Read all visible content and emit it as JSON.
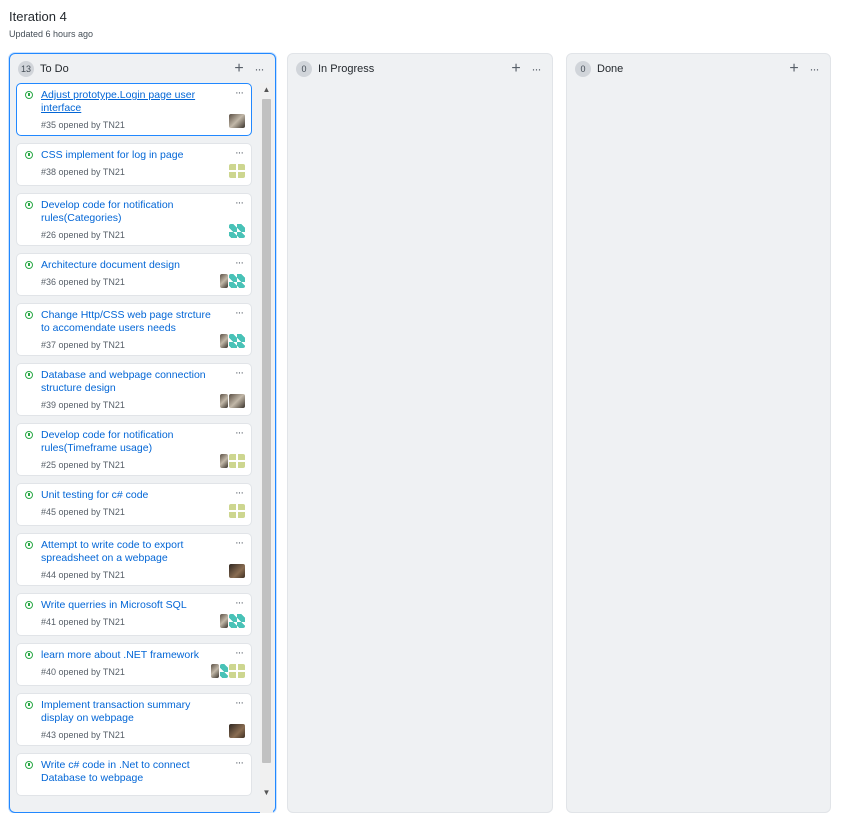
{
  "header": {
    "title": "Iteration 4",
    "updated": "Updated 6 hours ago"
  },
  "columns": [
    {
      "name": "To Do",
      "count": "13"
    },
    {
      "name": "In Progress",
      "count": "0"
    },
    {
      "name": "Done",
      "count": "0"
    }
  ],
  "icons": {
    "add": "plus-icon",
    "more": "kebab-icon",
    "issue": "issue-opened-icon"
  },
  "glyphs": {
    "add": "+",
    "more": "···",
    "scroll_up": "▲",
    "scroll_down": "▼"
  },
  "cards": [
    {
      "title": "Adjust prototype.Login page user interface",
      "meta": "#35 opened by TN21"
    },
    {
      "title": "CSS implement for log in page",
      "meta": "#38 opened by TN21"
    },
    {
      "title": "Develop code for notification rules(Categories)",
      "meta": "#26 opened by TN21"
    },
    {
      "title": "Architecture document design",
      "meta": "#36 opened by TN21"
    },
    {
      "title": "Change Http/CSS web page strcture to accomendate users needs",
      "meta": "#37 opened by TN21"
    },
    {
      "title": "Database and webpage connection structure design",
      "meta": "#39 opened by TN21"
    },
    {
      "title": "Develop code for notification rules(Timeframe usage)",
      "meta": "#25 opened by TN21"
    },
    {
      "title": "Unit testing for c# code",
      "meta": "#45 opened by TN21"
    },
    {
      "title": "Attempt to write code to export spreadsheet on a webpage",
      "meta": "#44 opened by TN21"
    },
    {
      "title": "Write querries in Microsoft SQL",
      "meta": "#41 opened by TN21"
    },
    {
      "title": "learn more about .NET framework",
      "meta": "#40 opened by TN21"
    },
    {
      "title": "Implement transaction summary display on webpage",
      "meta": "#43 opened by TN21"
    },
    {
      "title": "Write c# code in .Net to connect Database to webpage",
      "meta": ""
    }
  ]
}
